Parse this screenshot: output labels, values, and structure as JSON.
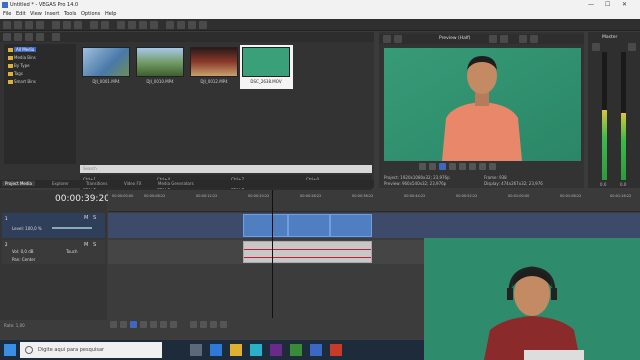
{
  "window": {
    "title": "Untitled * - VEGAS Pro 14.0",
    "controls": [
      "—",
      "☐",
      "✕"
    ]
  },
  "menu": [
    "File",
    "Edit",
    "View",
    "Insert",
    "Tools",
    "Options",
    "Help"
  ],
  "media_tree": {
    "items": [
      "All Media",
      "Media Bins",
      "By Type",
      "Tags",
      "Smart Bins"
    ],
    "selected": "All Media"
  },
  "media_files": [
    {
      "label": "DJI_0001.MP4",
      "color": "#6a8fb0"
    },
    {
      "label": "DJI_0010.MP4",
      "color": "#7a9a6a"
    },
    {
      "label": "DJI_0012.MP4",
      "color": "#8a5a4a"
    },
    {
      "label": "DSC_2638.MOV",
      "color": "#3aa07a",
      "selected": true
    }
  ],
  "search_placeholder": "Search",
  "props_grid": [
    "Ctrl+1",
    "Ctrl+4",
    "Ctrl+7",
    "Ctrl+0",
    "Ctrl+2",
    "Ctrl+5",
    "Ctrl+8",
    "Ctrl+3",
    "Ctrl+6",
    "Ctrl+9"
  ],
  "media_info": {
    "video": "Video: 1920x1080x12; 23,976 fps; 00:14:20:15, Alpha = None, Field Order = None (progressive scan), AVC",
    "audio": "Audio: 48.000 Hz; Stereo; 00:14:20:15, PCM"
  },
  "tabs": [
    "Project Media",
    "Explorer",
    "Transitions",
    "Video FX",
    "Media Generators"
  ],
  "active_tab": "Project Media",
  "preview": {
    "mode": "Preview (Half)",
    "project": "Project: 1920x1080x32; 23,976p",
    "preview": "Preview: 960x540x32; 23,976p",
    "frame": "Frame: 938",
    "display": "Display: 474x267x32; 23,976"
  },
  "master": {
    "label": "Master",
    "levels": [
      0.55,
      0.52
    ],
    "readouts": [
      "0.0",
      "0.0"
    ]
  },
  "timeline": {
    "timecode": "00:00:39:20",
    "ruler": [
      "00:00:00:00",
      "00:00:08:22",
      "00:00:12:22",
      "00:00:20:22",
      "00:00:28:22",
      "00:00:36:22",
      "00:00:44:22",
      "00:00:52:22",
      "00:01:00:00",
      "00:01:08:22",
      "00:01:16:22"
    ],
    "video_track": {
      "number": "1",
      "level": "Level: 100,0 %"
    },
    "audio_track": {
      "number": "2",
      "volume": "Vol: 0,0 dB",
      "pan": "Pan: Center",
      "mode": "Touch"
    },
    "rate": "Rate: 1,00"
  },
  "taskbar": {
    "search_placeholder": "Digite aqui para pesquisar"
  },
  "colors": {
    "accent": "#3c68c4",
    "video_bg": "#2f9270",
    "shirt": "#e8876a"
  }
}
